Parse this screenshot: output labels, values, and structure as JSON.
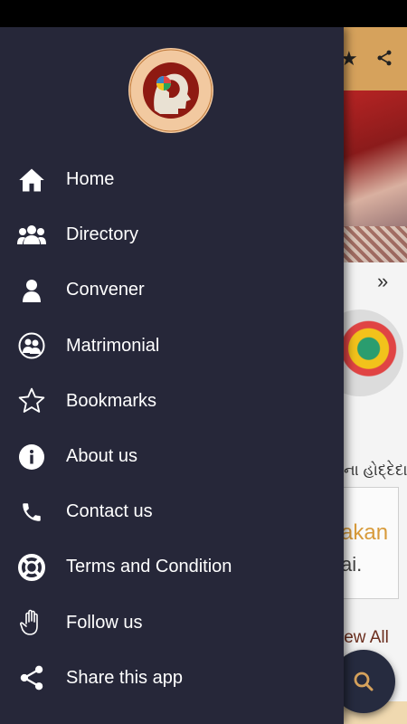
{
  "background_app": {
    "gujarati_text": "ના હોદ્દેદારો",
    "card_line1": "akan",
    "card_line2": "ai.",
    "view_all": "iew All",
    "chevron": "»"
  },
  "drawer": {
    "items": [
      {
        "label": "Home",
        "icon": "home-icon"
      },
      {
        "label": "Directory",
        "icon": "group-icon"
      },
      {
        "label": "Convener",
        "icon": "person-icon"
      },
      {
        "label": "Matrimonial",
        "icon": "couple-icon"
      },
      {
        "label": "Bookmarks",
        "icon": "star-icon"
      },
      {
        "label": "About us",
        "icon": "info-icon"
      },
      {
        "label": "Contact us",
        "icon": "phone-icon"
      },
      {
        "label": "Terms and Condition",
        "icon": "lifebuoy-icon"
      },
      {
        "label": "Follow us",
        "icon": "hand-icon"
      },
      {
        "label": "Share this app",
        "icon": "share-icon"
      }
    ]
  },
  "colors": {
    "drawer_bg": "#262739",
    "topbar": "#d6a25c",
    "logo_ring": "#f2c9a0",
    "logo_inner": "#8e1a12"
  }
}
